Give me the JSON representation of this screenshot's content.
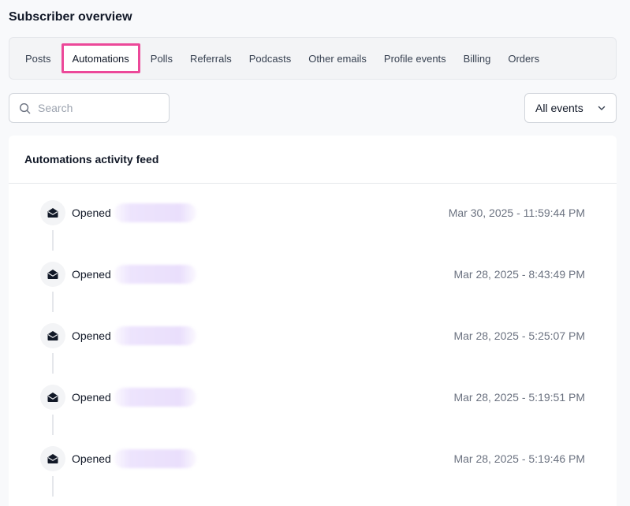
{
  "page": {
    "title": "Subscriber overview"
  },
  "tabs": [
    {
      "label": "Posts",
      "active": false
    },
    {
      "label": "Automations",
      "active": true
    },
    {
      "label": "Polls",
      "active": false
    },
    {
      "label": "Referrals",
      "active": false
    },
    {
      "label": "Podcasts",
      "active": false
    },
    {
      "label": "Other emails",
      "active": false
    },
    {
      "label": "Profile events",
      "active": false
    },
    {
      "label": "Billing",
      "active": false
    },
    {
      "label": "Orders",
      "active": false
    }
  ],
  "search": {
    "placeholder": "Search",
    "value": "",
    "icon": "search-icon"
  },
  "filter": {
    "selected": "All events",
    "icon": "chevron-down-icon"
  },
  "feed": {
    "title": "Automations activity feed",
    "events": [
      {
        "action": "Opened",
        "timestamp": "Mar 30, 2025 - 11:59:44 PM",
        "icon": "envelope-open-icon"
      },
      {
        "action": "Opened",
        "timestamp": "Mar 28, 2025 - 8:43:49 PM",
        "icon": "envelope-open-icon"
      },
      {
        "action": "Opened",
        "timestamp": "Mar 28, 2025 - 5:25:07 PM",
        "icon": "envelope-open-icon"
      },
      {
        "action": "Opened",
        "timestamp": "Mar 28, 2025 - 5:19:51 PM",
        "icon": "envelope-open-icon"
      },
      {
        "action": "Opened",
        "timestamp": "Mar 28, 2025 - 5:19:46 PM",
        "icon": "envelope-open-icon"
      }
    ]
  },
  "colors": {
    "accent": "#ec4899",
    "background": "#f8f9fb",
    "muted_text": "#6b7280"
  }
}
